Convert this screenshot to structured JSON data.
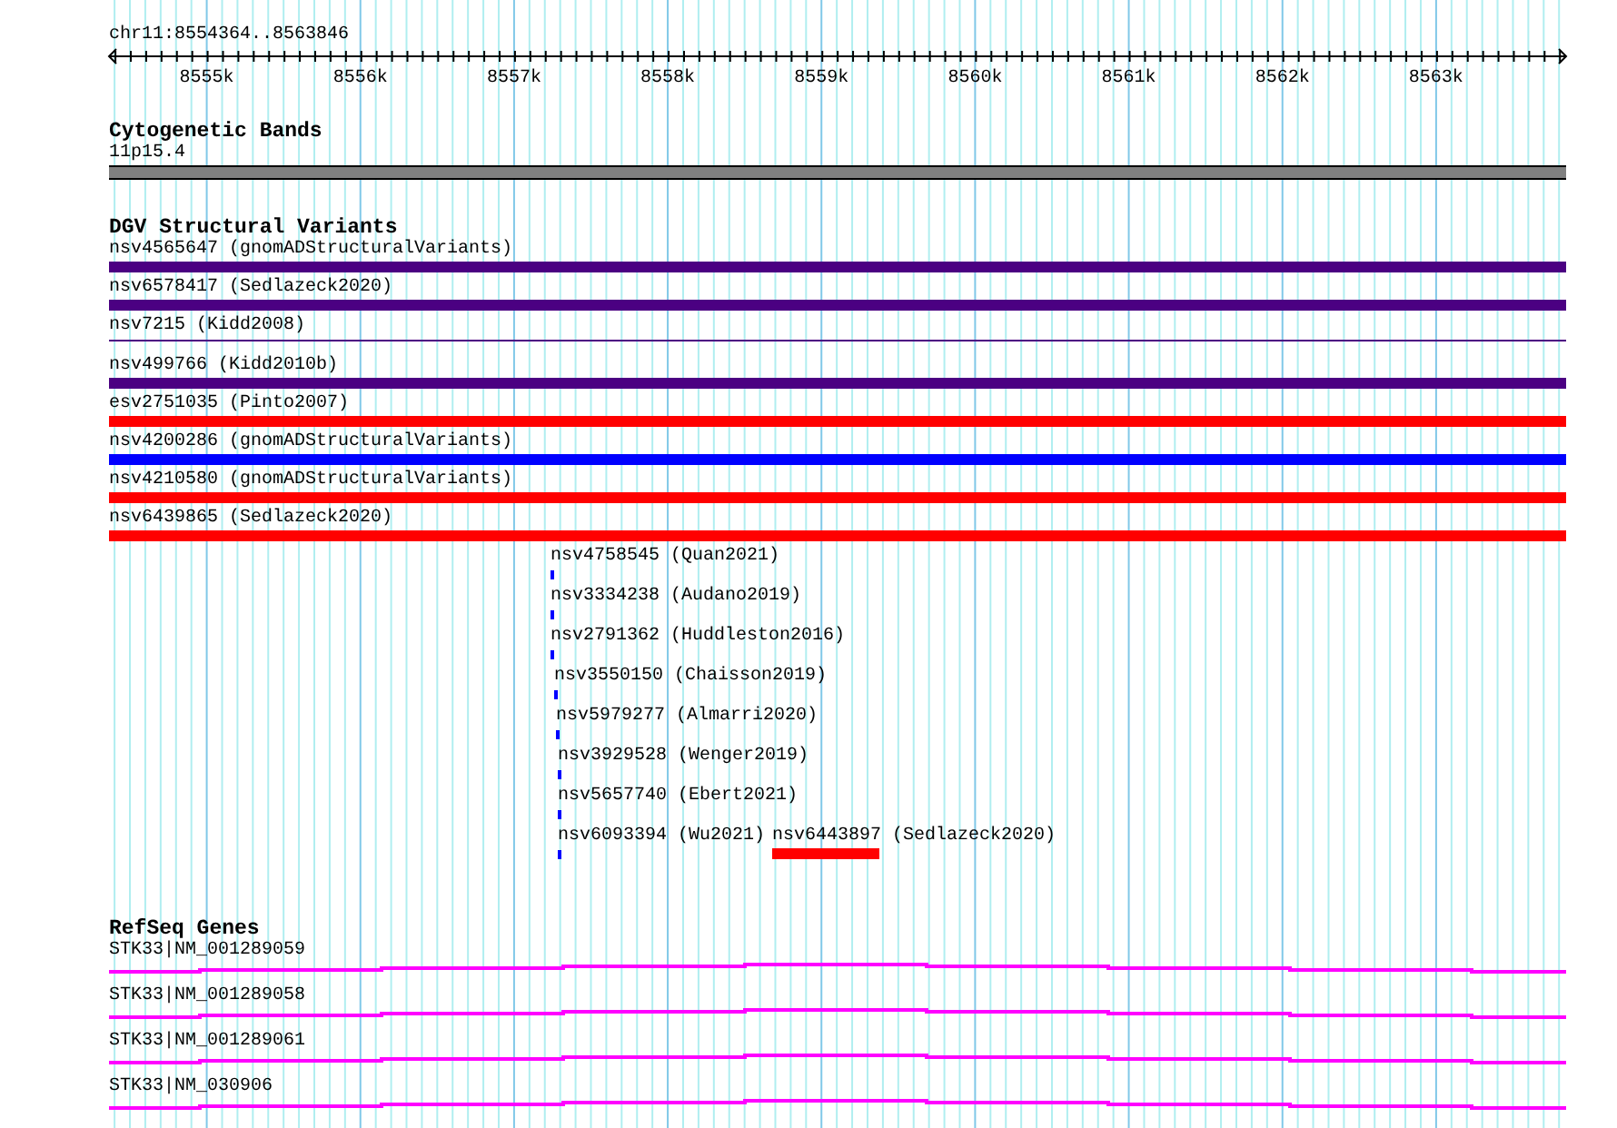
{
  "ruler": {
    "label": "chr11:8554364..8563846",
    "ticks": [
      "8555k",
      "8556k",
      "8557k",
      "8558k",
      "8559k",
      "8560k",
      "8561k",
      "8562k",
      "8563k"
    ]
  },
  "cytogenetic_bands": {
    "title": "Cytogenetic Bands",
    "band": "11p15.4"
  },
  "dgv": {
    "title": "DGV Structural Variants",
    "features": [
      {
        "label": "nsv4565647 (gnomADStructuralVariants)",
        "kind": "bar",
        "color": "#4b0082"
      },
      {
        "label": "nsv6578417 (Sedlazeck2020)",
        "kind": "bar",
        "color": "#4b0082"
      },
      {
        "label": "nsv7215 (Kidd2008)",
        "kind": "line",
        "color": "#4b0082"
      },
      {
        "label": "nsv499766 (Kidd2010b)",
        "kind": "bar",
        "color": "#4b0082"
      },
      {
        "label": "esv2751035 (Pinto2007)",
        "kind": "bar",
        "color": "#ff0000"
      },
      {
        "label": "nsv4200286 (gnomADStructuralVariants)",
        "kind": "bar",
        "color": "#0000ff"
      },
      {
        "label": "nsv4210580 (gnomADStructuralVariants)",
        "kind": "bar",
        "color": "#ff0000"
      },
      {
        "label": "nsv6439865 (Sedlazeck2020)",
        "kind": "bar",
        "color": "#ff0000"
      }
    ],
    "stacked_rows": [
      {
        "features": [
          {
            "label": "nsv4758545 (Quan2021)",
            "kind": "tick",
            "color": "#0000ff"
          }
        ]
      },
      {
        "features": [
          {
            "label": "nsv3334238 (Audano2019)",
            "kind": "tick",
            "color": "#0000ff"
          }
        ]
      },
      {
        "features": [
          {
            "label": "nsv2791362 (Huddleston2016)",
            "kind": "tick",
            "color": "#0000ff"
          }
        ]
      },
      {
        "features": [
          {
            "label": "nsv3550150 (Chaisson2019)",
            "kind": "tick",
            "color": "#0000ff"
          }
        ]
      },
      {
        "features": [
          {
            "label": "nsv5979277 (Almarri2020)",
            "kind": "tick",
            "color": "#0000ff"
          }
        ]
      },
      {
        "features": [
          {
            "label": "nsv3929528 (Wenger2019)",
            "kind": "tick",
            "color": "#0000ff"
          }
        ]
      },
      {
        "features": [
          {
            "label": "nsv5657740 (Ebert2021)",
            "kind": "tick",
            "color": "#0000ff"
          }
        ]
      },
      {
        "features": [
          {
            "label": "nsv6093394 (Wu2021)",
            "kind": "tick",
            "color": "#0000ff"
          },
          {
            "label": "nsv6443897 (Sedlazeck2020)",
            "kind": "bar",
            "color": "#ff0000"
          }
        ]
      }
    ]
  },
  "refseq": {
    "title": "RefSeq Genes",
    "transcripts": [
      "STK33|NM_001289059",
      "STK33|NM_001289058",
      "STK33|NM_001289061",
      "STK33|NM_030906"
    ]
  }
}
